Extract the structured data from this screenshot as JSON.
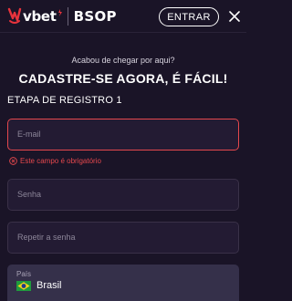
{
  "header": {
    "logo_text": "vbet",
    "partner_text": "BSOP",
    "login_label": "ENTRAR",
    "brand_color": "#e8333c"
  },
  "form": {
    "subtitle": "Acabou de chegar por aqui?",
    "headline": "CADASTRE-SE AGORA, É FÁCIL!",
    "step_label": "ETAPA DE REGISTRO 1",
    "email": {
      "placeholder": "E-mail",
      "error": "Este campo é obrigatório"
    },
    "password": {
      "placeholder": "Senha"
    },
    "repeat_password": {
      "placeholder": "Repetir a senha"
    },
    "country": {
      "label": "País",
      "value": "Brasil",
      "flag_icon": "brazil-flag-icon"
    }
  },
  "colors": {
    "background": "#1a1427",
    "field_bg": "#231b33",
    "error": "#e5484d"
  }
}
